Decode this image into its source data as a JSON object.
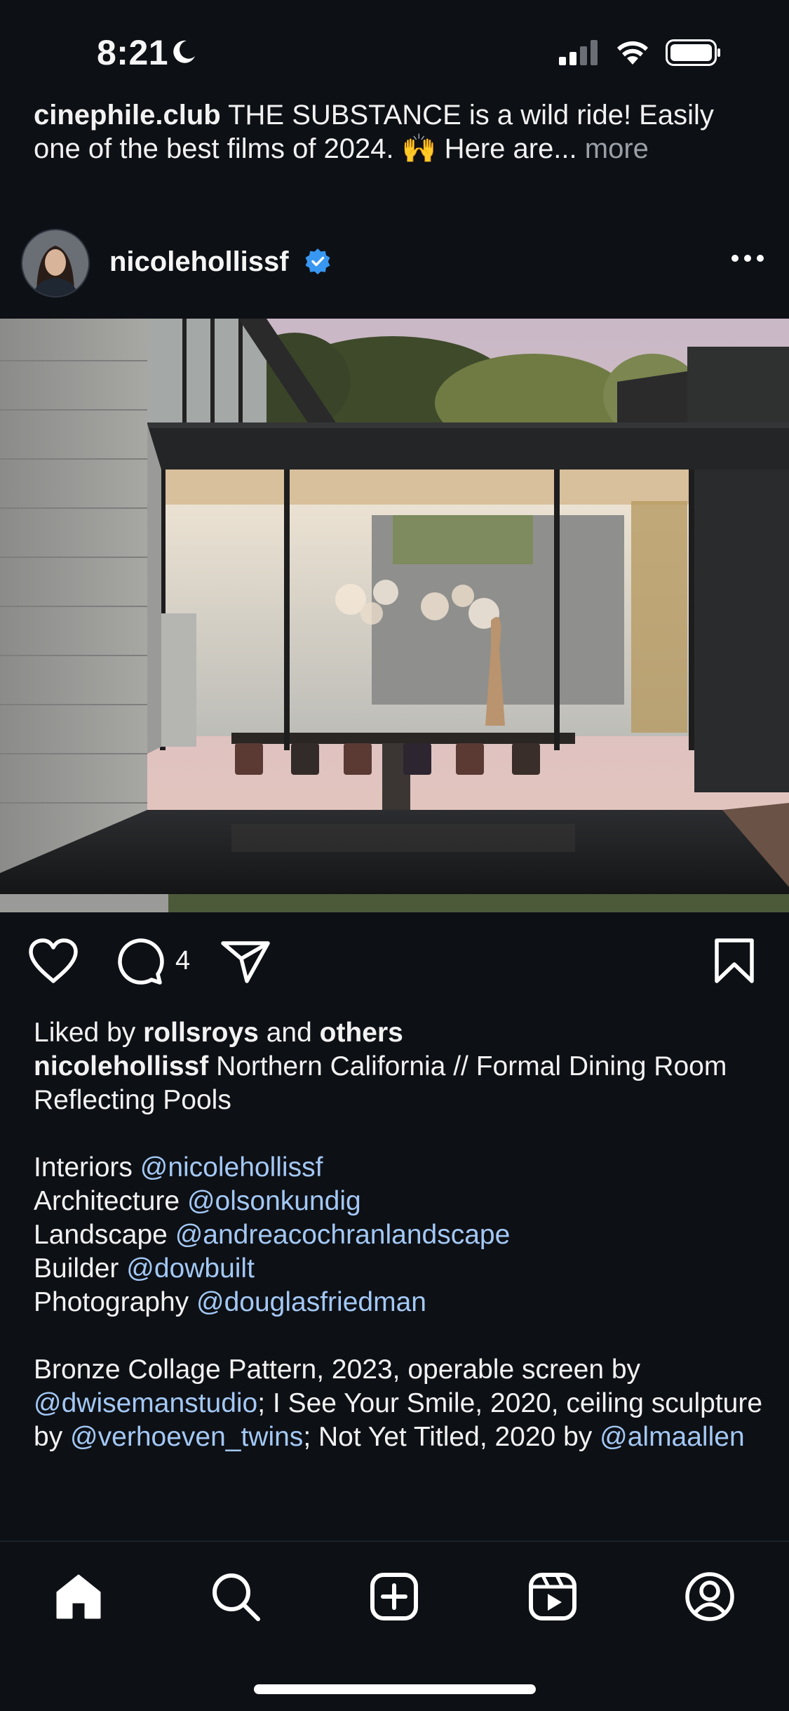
{
  "status_bar": {
    "time": "8:21"
  },
  "previous_post": {
    "username": "cinephile.club",
    "text": "THE SUBSTANCE is a wild ride! Easily one of the best films of 2024. 🙌 Here are...",
    "more_label": "more"
  },
  "post": {
    "username": "nicolehollissf",
    "verified": true,
    "comment_count": "4",
    "liked_by": {
      "prefix": "Liked by",
      "user": "rollsroys",
      "conj": "and",
      "others": "others"
    },
    "caption": {
      "username": "nicolehollissf",
      "intro": "Northern California // Formal Dining Room Reflecting Pools",
      "credits": [
        {
          "role": "Interiors",
          "handle": "@nicolehollissf"
        },
        {
          "role": "Architecture",
          "handle": "@olsonkundig"
        },
        {
          "role": "Landscape",
          "handle": "@andreacochranlandscape"
        },
        {
          "role": "Builder",
          "handle": "@dowbuilt"
        },
        {
          "role": "Photography",
          "handle": "@douglasfriedman"
        }
      ],
      "art": {
        "p1": "Bronze Collage Pattern, 2023, operable screen by",
        "m1": "@dwisemanstudio",
        "p2": "; I See Your Smile, 2020, ceiling sculpture by",
        "m2": "@verhoeven_twins",
        "p3": "; Not Yet Titled, 2020 by",
        "m3": "@almaallen"
      }
    }
  },
  "tabs": [
    "home-icon",
    "search-icon",
    "create-icon",
    "reels-icon",
    "profile-icon"
  ],
  "colors": {
    "background": "#0d1015",
    "mention": "#a3c8f5",
    "verified": "#3897f0",
    "muted": "#9aa0a6"
  }
}
